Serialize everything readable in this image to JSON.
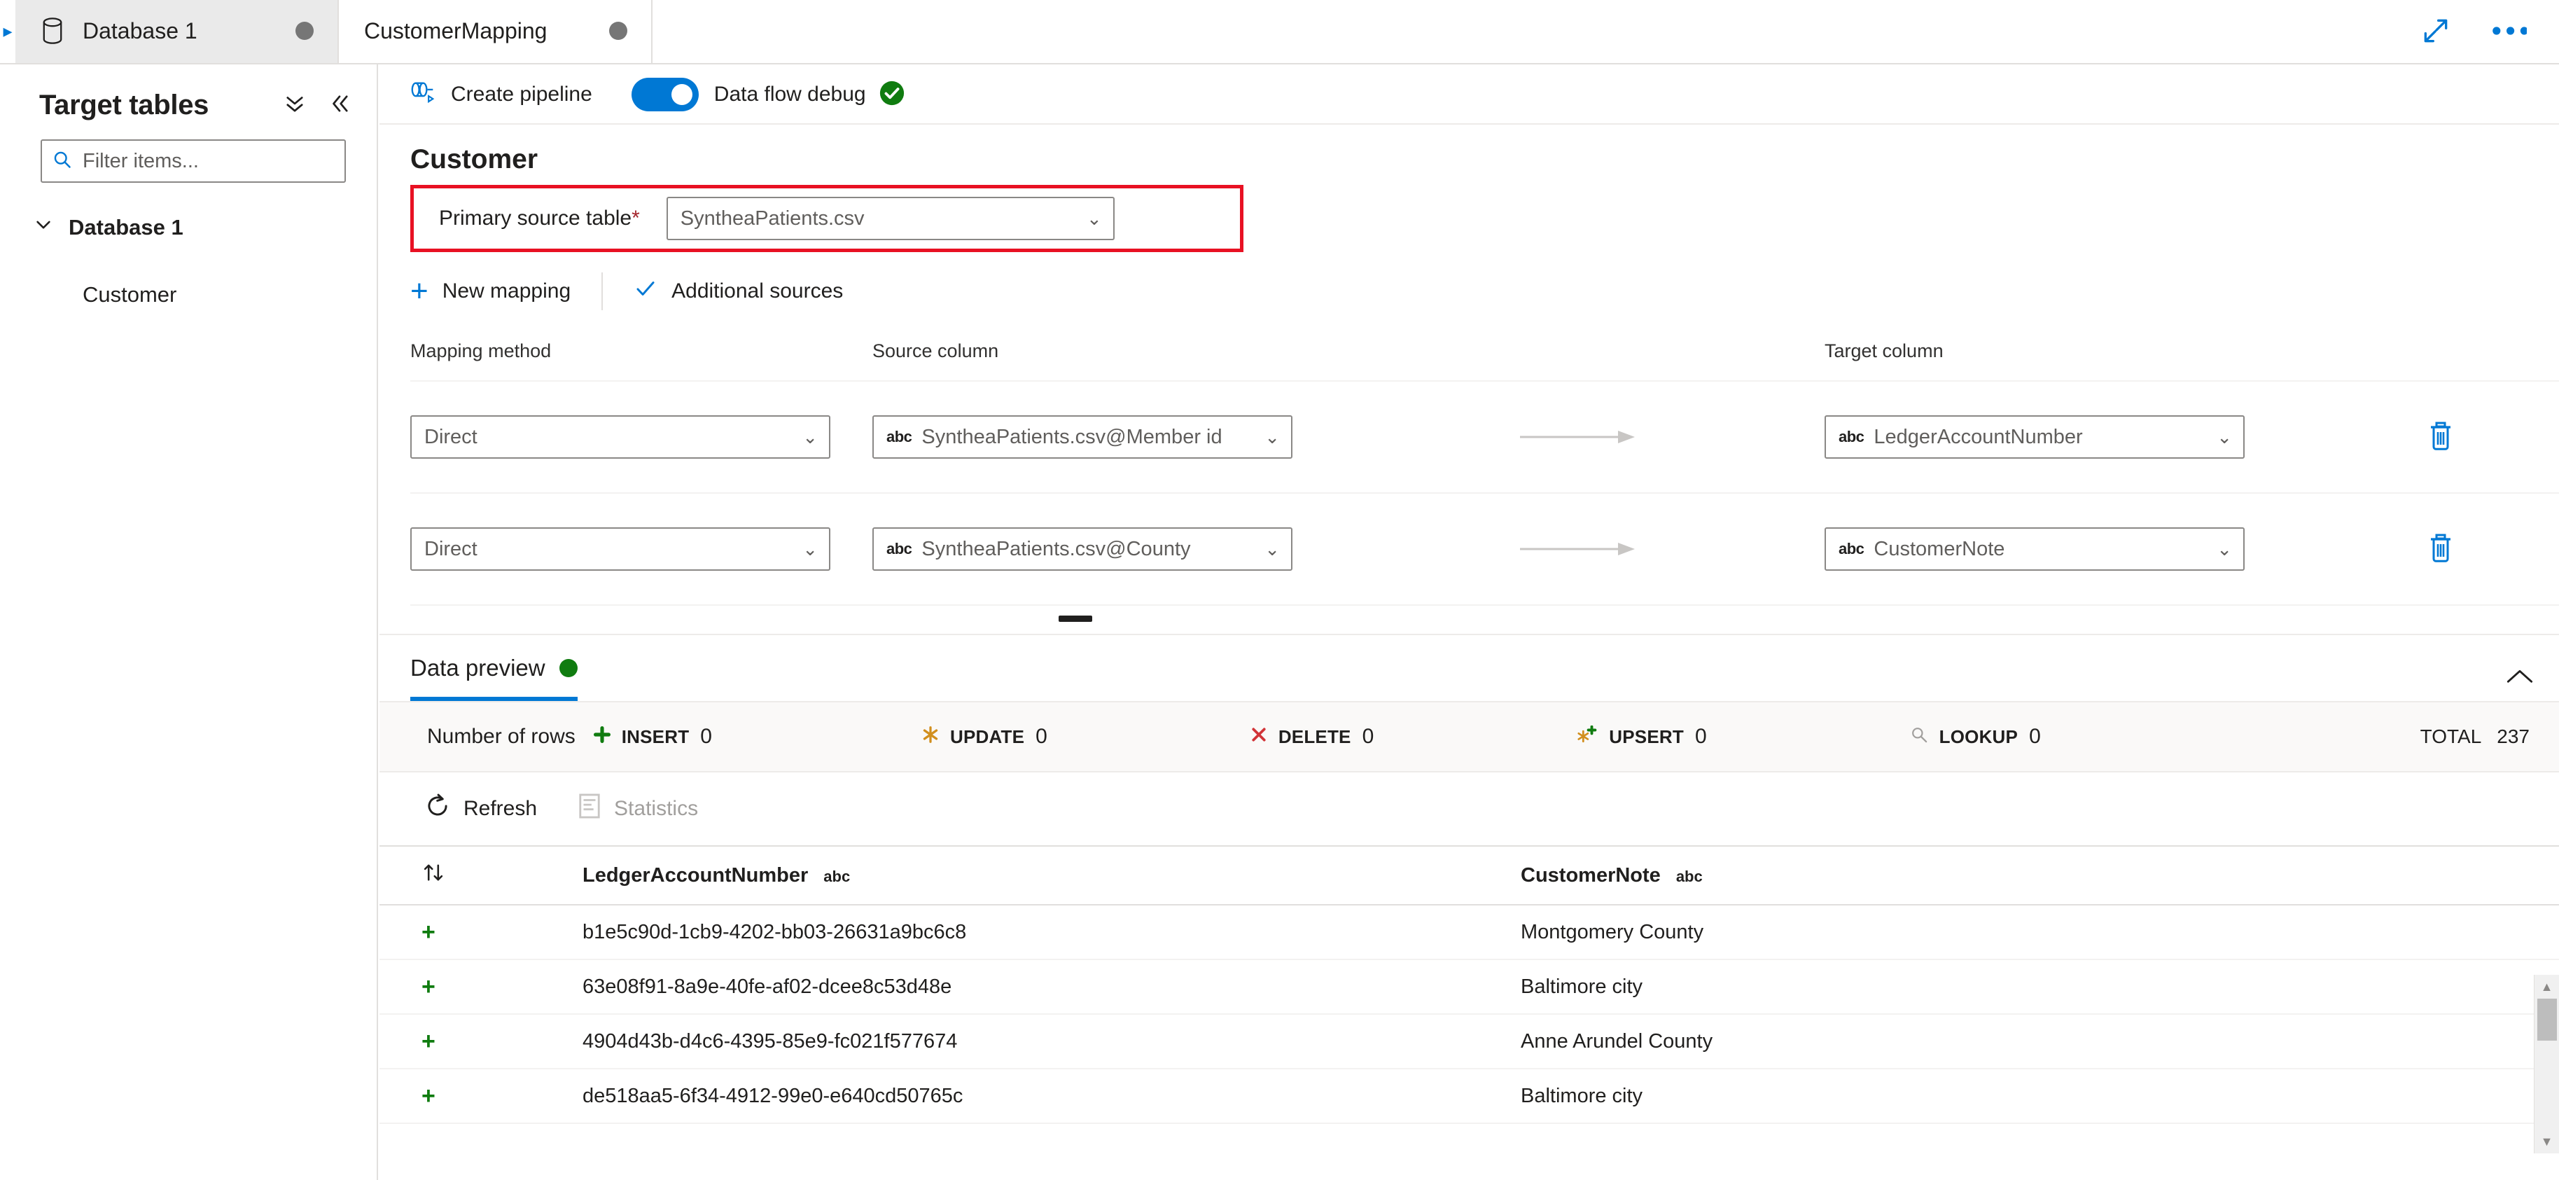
{
  "tabs": [
    {
      "label": "Database 1",
      "icon": "database-icon",
      "active": false,
      "modified": true
    },
    {
      "label": "CustomerMapping",
      "icon": "",
      "active": true,
      "modified": true
    }
  ],
  "window_tools": {
    "expand_label": "expand-icon",
    "more_label": "more-options-icon"
  },
  "sidebar": {
    "title": "Target tables",
    "collapse_all_icon": "chevron-double-down-icon",
    "collapse_panel_icon": "chevron-double-left-icon",
    "filter": {
      "placeholder": "Filter items...",
      "value": "",
      "icon": "search-icon"
    },
    "tree": {
      "root": {
        "label": "Database 1",
        "expanded": true
      },
      "children": [
        {
          "label": "Customer"
        }
      ]
    }
  },
  "toolbar": {
    "create_pipeline": "Create pipeline",
    "create_pipeline_icon": "pipeline-icon",
    "data_flow_debug": "Data flow debug",
    "debug_on": true,
    "debug_status_icon": "check-circle-icon"
  },
  "mapping": {
    "entity_title": "Customer",
    "primary_source_label": "Primary source table",
    "primary_source_required": "*",
    "primary_source_value": "SyntheaPatients.csv",
    "highlight_color": "#e81123",
    "new_mapping_label": "New mapping",
    "additional_sources_label": "Additional sources",
    "headers": {
      "mapping_method": "Mapping method",
      "source_column": "Source column",
      "target_column": "Target column"
    },
    "rows": [
      {
        "method": "Direct",
        "source": "SyntheaPatients.csv@Member id",
        "source_type": "abc",
        "target": "LedgerAccountNumber",
        "target_type": "abc",
        "delete_icon": "trash-icon"
      },
      {
        "method": "Direct",
        "source": "SyntheaPatients.csv@County",
        "source_type": "abc",
        "target": "CustomerNote",
        "target_type": "abc",
        "delete_icon": "trash-icon"
      }
    ]
  },
  "data_preview": {
    "tab_label": "Data preview",
    "status_dot_color": "#107c10",
    "collapse_icon": "chevron-up-icon",
    "counts": {
      "label": "Number of rows",
      "items": [
        {
          "key": "INSERT",
          "value": "0",
          "icon": "plus-icon",
          "color": "#107c10"
        },
        {
          "key": "UPDATE",
          "value": "0",
          "icon": "asterisk-icon",
          "color": "#d18f1e"
        },
        {
          "key": "DELETE",
          "value": "0",
          "icon": "x-icon",
          "color": "#d13438"
        },
        {
          "key": "UPSERT",
          "value": "0",
          "icon": "asterisk-plus-icon",
          "color": "#d18f1e"
        },
        {
          "key": "LOOKUP",
          "value": "0",
          "icon": "search-icon",
          "color": "#a19f9d"
        }
      ],
      "total_key": "TOTAL",
      "total_value": "237"
    },
    "toolbar": {
      "refresh": "Refresh",
      "refresh_icon": "refresh-icon",
      "statistics": "Statistics",
      "statistics_icon": "statistics-icon",
      "statistics_disabled": true
    },
    "table": {
      "sort_icon": "sort-icon",
      "columns": [
        {
          "name": "LedgerAccountNumber",
          "type": "abc"
        },
        {
          "name": "CustomerNote",
          "type": "abc"
        }
      ],
      "rows": [
        {
          "op": "+",
          "LedgerAccountNumber": "b1e5c90d-1cb9-4202-bb03-26631a9bc6c8",
          "CustomerNote": "Montgomery County"
        },
        {
          "op": "+",
          "LedgerAccountNumber": "63e08f91-8a9e-40fe-af02-dcee8c53d48e",
          "CustomerNote": "Baltimore city"
        },
        {
          "op": "+",
          "LedgerAccountNumber": "4904d43b-d4c6-4395-85e9-fc021f577674",
          "CustomerNote": "Anne Arundel County"
        },
        {
          "op": "+",
          "LedgerAccountNumber": "de518aa5-6f34-4912-99e0-e640cd50765c",
          "CustomerNote": "Baltimore city"
        }
      ]
    }
  },
  "colors": {
    "accent": "#0078d4",
    "success": "#107c10",
    "danger": "#d13438",
    "warning": "#d18f1e",
    "highlight": "#e81123"
  }
}
